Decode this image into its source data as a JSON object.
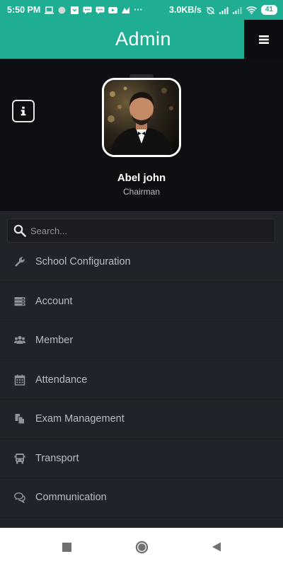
{
  "status_bar": {
    "time": "5:50 PM",
    "dots": "···",
    "speed": "3.0KB/s",
    "battery": "41"
  },
  "header": {
    "title": "Admin"
  },
  "profile": {
    "name": "Abel john",
    "role": "Chairman"
  },
  "search": {
    "placeholder": "Search..."
  },
  "menu": {
    "items": [
      {
        "label": "School Configuration",
        "icon": "wrench-icon"
      },
      {
        "label": "Account",
        "icon": "server-icon"
      },
      {
        "label": "Member",
        "icon": "users-icon"
      },
      {
        "label": "Attendance",
        "icon": "calendar-icon"
      },
      {
        "label": "Exam Management",
        "icon": "documents-icon"
      },
      {
        "label": "Transport",
        "icon": "bus-icon"
      },
      {
        "label": "Communication",
        "icon": "chat-icon"
      }
    ]
  },
  "colors": {
    "accent": "#1fae91",
    "sidebar_bg": "#20232a",
    "profile_bg": "#0e0f12",
    "text_muted": "#b8bcc3"
  }
}
